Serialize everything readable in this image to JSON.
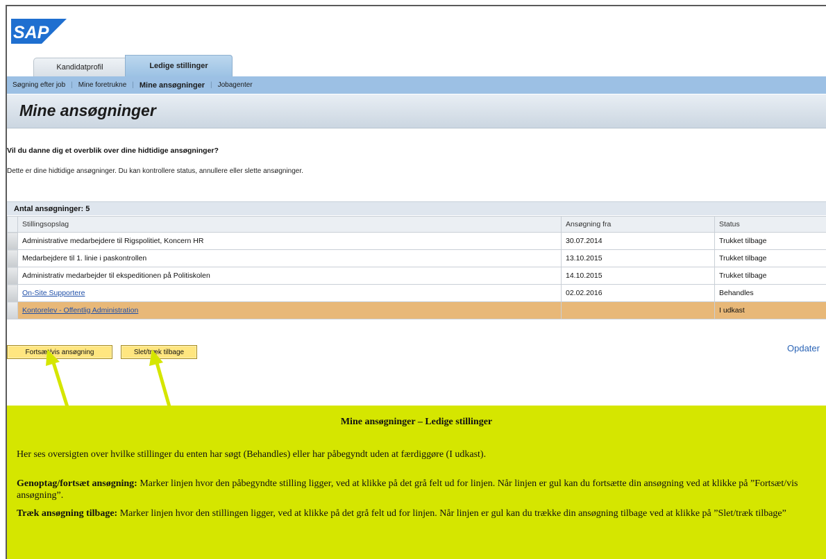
{
  "logo": {
    "text": "SAP"
  },
  "tabs": [
    {
      "label": "Kandidatprofil",
      "active": false
    },
    {
      "label": "Ledige stillinger",
      "active": true
    }
  ],
  "subnav": {
    "items": [
      "Søgning efter job",
      "Mine foretrukne",
      "Mine ansøgninger",
      "Jobagenter"
    ],
    "active_index": 2
  },
  "page": {
    "title": "Mine ansøgninger",
    "question": "Vil du danne dig et overblik over dine hidtidige ansøgninger?",
    "description": "Dette er dine hidtidige ansøgninger. Du kan kontrollere status, annullere eller slette ansøgninger."
  },
  "table": {
    "count_label": "Antal ansøgninger: 5",
    "columns": [
      "Stillingsopslag",
      "Ansøgning fra",
      "Status"
    ],
    "rows": [
      {
        "title": "Administrative medarbejdere til Rigspolitiet, Koncern HR",
        "date": "30.07.2014",
        "status": "Trukket tilbage",
        "link": false,
        "selected": false
      },
      {
        "title": "Medarbejdere til 1. linie i paskontrollen",
        "date": "13.10.2015",
        "status": "Trukket tilbage",
        "link": false,
        "selected": false
      },
      {
        "title": "Administrativ medarbejder til ekspeditionen på Politiskolen",
        "date": "14.10.2015",
        "status": "Trukket tilbage",
        "link": false,
        "selected": false
      },
      {
        "title": "On-Site Supportere",
        "date": "02.02.2016",
        "status": "Behandles",
        "link": true,
        "selected": false
      },
      {
        "title": "Kontorelev - Offentlig Administration",
        "date": "",
        "status": "I udkast",
        "link": true,
        "selected": true
      }
    ]
  },
  "actions": {
    "update_label": "Opdater",
    "continue_label": "Fortsæt/vis ansøgning",
    "delete_label": "Slet/træk tilbage"
  },
  "note": {
    "title": "Mine ansøgninger – Ledige stillinger",
    "intro": "Her ses oversigten over hvilke stillinger du enten har søgt (Behandles) eller har påbegyndt uden at færdiggøre (I udkast).",
    "resume_heading": "Genoptag/fortsæt ansøgning:",
    "resume_text": " Marker linjen hvor den påbegyndte stilling ligger, ved at klikke på det grå felt ud for linjen. Når linjen er gul kan du fortsætte din ansøgning ved at klikke på ”Fortsæt/vis ansøgning”.",
    "withdraw_heading": "Træk ansøgning tilbage:",
    "withdraw_text": " Marker linjen hvor den stillingen ligger, ved at klikke på det grå felt ud for linjen. Når linjen er gul kan du trække din ansøgning tilbage ved at klikke på ”Slet/træk tilbage”"
  },
  "colors": {
    "nav_blue": "#9cc0e4",
    "selected_row": "#e8b878",
    "note_bg": "#d5e600",
    "button_bg": "#ffe680",
    "arrow": "#d5e600"
  }
}
